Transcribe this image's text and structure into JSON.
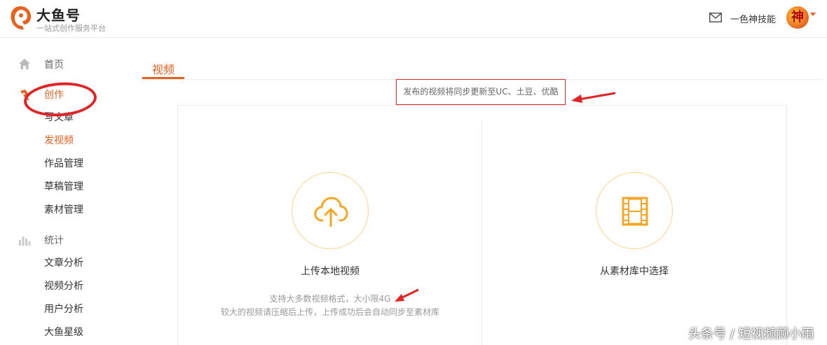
{
  "header": {
    "brand_name": "大鱼号",
    "brand_tagline": "一站式创作服务平台",
    "username": "一色神技能",
    "avatar_text": "神"
  },
  "sidebar": {
    "home_label": "首页",
    "create_label": "创作",
    "create_items": [
      "写文章",
      "发视频",
      "作品管理",
      "草稿管理",
      "素材管理"
    ],
    "active_item": "发视频",
    "stats_label": "统计",
    "stats_items": [
      "文章分析",
      "视频分析",
      "用户分析",
      "大鱼星级"
    ]
  },
  "main": {
    "tab_label": "视频",
    "notice": "发布的视频将同步更新至UC、土豆、优酷",
    "upload_card": {
      "title": "上传本地视频",
      "hint_line1": "支持大多数视频格式，大小限4G",
      "hint_line2": "较大的视频请压缩后上传，上传成功后会自动同步至素材库"
    },
    "library_card": {
      "title": "从素材库中选择"
    }
  },
  "watermark": "头条号 / 短视频顾小雨",
  "colors": {
    "accent": "#e8611f",
    "icon_orange": "#f5a623",
    "annotation_red": "#e02426"
  },
  "icons": {
    "logo": "fish-logo",
    "mail": "mail-icon",
    "home": "home-icon",
    "create": "pen-icon",
    "stats": "bar-chart-icon",
    "upload": "cloud-upload-icon",
    "library": "film-icon"
  }
}
